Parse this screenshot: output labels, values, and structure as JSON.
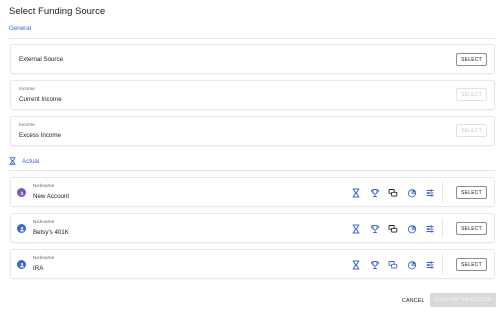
{
  "dialog": {
    "title": "Select Funding Source"
  },
  "general": {
    "label": "General",
    "items": [
      {
        "sub": "",
        "name": "External Source",
        "button": "SELECT",
        "enabled": true
      },
      {
        "sub": "Income",
        "name": "Current Income",
        "button": "SELECT",
        "enabled": false
      },
      {
        "sub": "Income",
        "name": "Excess Income",
        "button": "SELECT",
        "enabled": false
      }
    ]
  },
  "actual": {
    "label": "Actual",
    "icon": "hourglass-icon",
    "accounts": [
      {
        "sub": "Nickname",
        "name": "New Account",
        "icon": "dollar-icon",
        "icon_color": "#7e57c2",
        "button": "SELECT"
      },
      {
        "sub": "Nickname",
        "name": "Betsy's 401K",
        "icon": "person-icon",
        "icon_color": "#3a66d8",
        "button": "SELECT"
      },
      {
        "sub": "Nickname",
        "name": "IRA",
        "icon": "person-icon",
        "icon_color": "#3a66d8",
        "button": "SELECT"
      }
    ],
    "tool_icons": [
      "hourglass-icon",
      "trophy-icon",
      "chat-icon",
      "pie-chart-icon",
      "sliders-icon"
    ]
  },
  "footer": {
    "cancel": "CANCEL",
    "confirm": "CONFIRM SELECTION"
  },
  "colors": {
    "accent": "#3a66d8",
    "purple": "#7e57c2",
    "disabled": "#d9d9d9"
  }
}
